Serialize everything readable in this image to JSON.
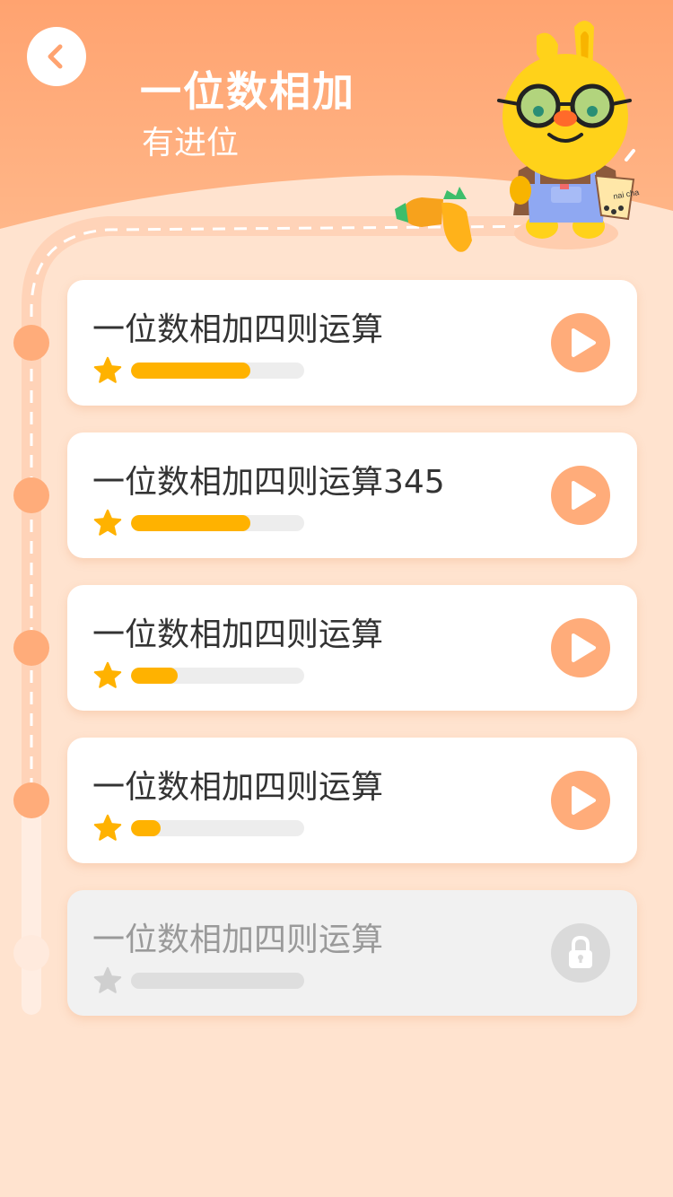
{
  "header": {
    "title": "一位数相加",
    "subtitle": "有进位",
    "mascot_cup_text": "nai cha"
  },
  "lessons": [
    {
      "title": "一位数相加四则运算",
      "progress": 0.69,
      "locked": false
    },
    {
      "title": "一位数相加四则运算345",
      "progress": 0.69,
      "locked": false
    },
    {
      "title": "一位数相加四则运算",
      "progress": 0.27,
      "locked": false
    },
    {
      "title": "一位数相加四则运算",
      "progress": 0.17,
      "locked": false
    },
    {
      "title": "一位数相加四则运算",
      "progress": 0,
      "locked": true
    }
  ],
  "colors": {
    "header_orange": "#FFAC7A",
    "background": "#FFE3CF",
    "progress_fill": "#FFB200",
    "progress_track": "#EDEDED",
    "play_button": "#FFAC7A",
    "locked_card": "#F1F1F1",
    "locked_icon": "#DADADA",
    "star": "#FFB200",
    "star_locked": "#CFCFCF"
  },
  "icons": {
    "back": "chevron-left-icon",
    "play": "play-icon",
    "lock": "lock-icon",
    "star": "star-icon"
  }
}
